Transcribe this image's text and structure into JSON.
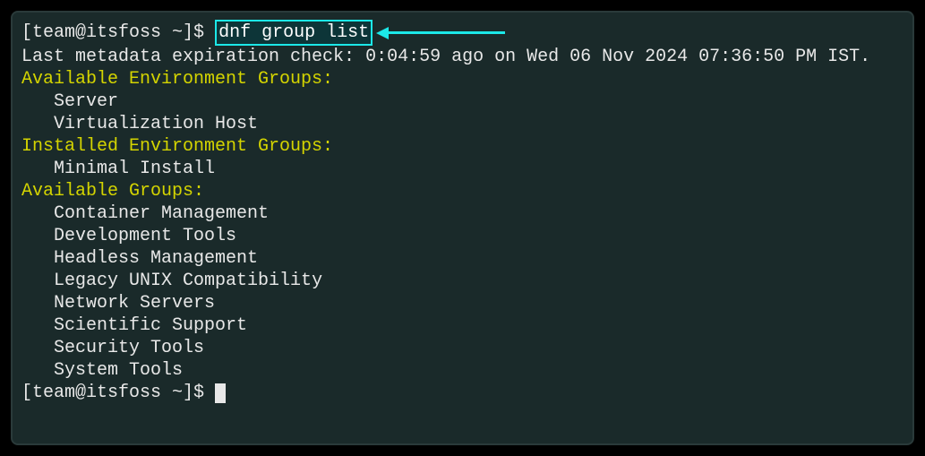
{
  "prompt": {
    "user_host": "[team@itsfoss ~]$",
    "command": "dnf group list"
  },
  "output": {
    "metadata_line": "Last metadata expiration check: 0:04:59 ago on Wed 06 Nov 2024 07:36:50 PM IST.",
    "sections": {
      "available_env": {
        "title": "Available Environment Groups:",
        "items": [
          "Server",
          "Virtualization Host"
        ]
      },
      "installed_env": {
        "title": "Installed Environment Groups:",
        "items": [
          "Minimal Install"
        ]
      },
      "available_groups": {
        "title": "Available Groups:",
        "items": [
          "Container Management",
          "Development Tools",
          "Headless Management",
          "Legacy UNIX Compatibility",
          "Network Servers",
          "Scientific Support",
          "Security Tools",
          "System Tools"
        ]
      }
    },
    "final_prompt": "[team@itsfoss ~]$ "
  }
}
